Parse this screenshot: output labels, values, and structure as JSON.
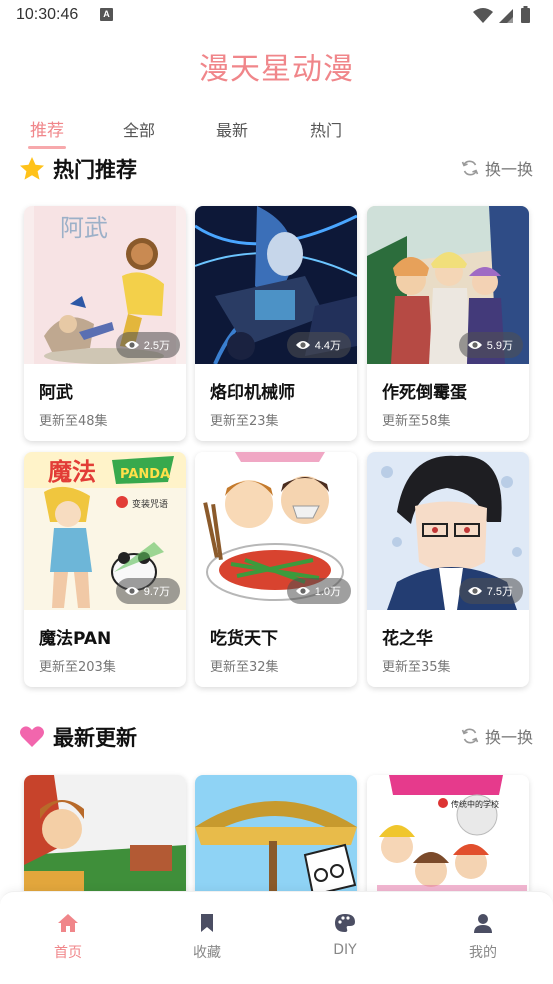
{
  "status_bar": {
    "time": "10:30:46",
    "badge": "A"
  },
  "app": {
    "title": "漫天星动漫",
    "accent": "#f0868a"
  },
  "tabs": [
    {
      "label": "推荐",
      "active": true
    },
    {
      "label": "全部",
      "active": false
    },
    {
      "label": "最新",
      "active": false
    },
    {
      "label": "热门",
      "active": false
    }
  ],
  "sections": {
    "hot": {
      "title": "热门推荐",
      "icon": "star-icon",
      "refresh_label": "换一换"
    },
    "latest": {
      "title": "最新更新",
      "icon": "heart-icon",
      "refresh_label": "换一换"
    }
  },
  "hot_cards": [
    {
      "title": "阿武",
      "subtitle": "更新至48集",
      "views": "2.5万"
    },
    {
      "title": "烙印机械师",
      "subtitle": "更新至23集",
      "views": "4.4万"
    },
    {
      "title": "作死倒霉蛋",
      "subtitle": "更新至58集",
      "views": "5.9万"
    },
    {
      "title": "魔法PAN",
      "subtitle": "更新至203集",
      "views": "9.7万"
    },
    {
      "title": "吃货天下",
      "subtitle": "更新至32集",
      "views": "1.0万"
    },
    {
      "title": "花之华",
      "subtitle": "更新至35集",
      "views": "7.5万"
    }
  ],
  "cover_texts": {
    "awu": "阿武",
    "magic": "魔法",
    "panda": "PANDA",
    "magic_sub": "变装咒语",
    "school": "传统中的学校"
  },
  "bottom_nav": [
    {
      "label": "首页",
      "icon": "home-icon",
      "active": true
    },
    {
      "label": "收藏",
      "icon": "bookmark-icon",
      "active": false
    },
    {
      "label": "DIY",
      "icon": "palette-icon",
      "active": false
    },
    {
      "label": "我的",
      "icon": "user-icon",
      "active": false
    }
  ]
}
